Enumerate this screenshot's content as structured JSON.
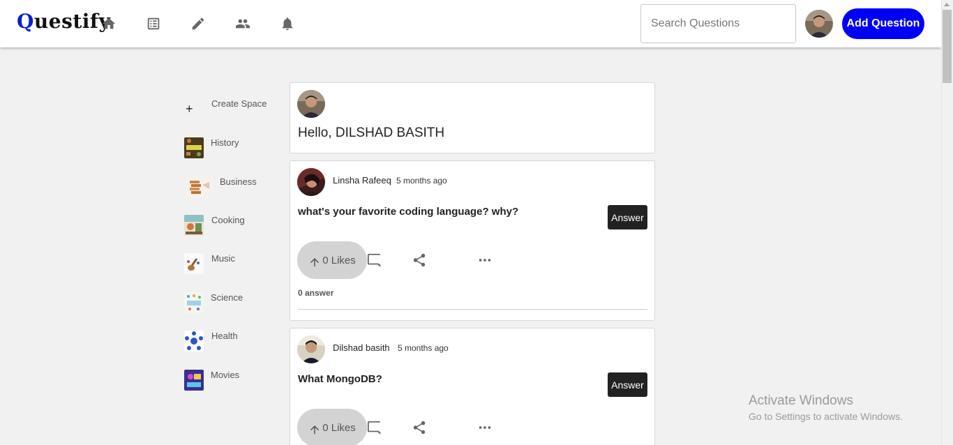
{
  "header": {
    "logo_first": "Q",
    "logo_rest": "uestify",
    "nav": [
      "home-icon",
      "list-icon",
      "edit-icon",
      "people-icon",
      "bell-icon"
    ],
    "search_placeholder": "Search Questions",
    "add_button": "Add Question"
  },
  "sidebar": {
    "create_label": "Create Space",
    "items": [
      {
        "label": "History"
      },
      {
        "label": "Business"
      },
      {
        "label": "Cooking"
      },
      {
        "label": "Music"
      },
      {
        "label": "Science"
      },
      {
        "label": "Health"
      },
      {
        "label": "Movies"
      }
    ]
  },
  "feed": {
    "greeting": "Hello, DILSHAD BASITH",
    "posts": [
      {
        "user": "Linsha Rafeeq",
        "time": "5 months ago",
        "question": "what's your favorite coding language? why?",
        "answer_button": "Answer",
        "likes": "0 Likes",
        "answers": "0 answer"
      },
      {
        "user": "Dilshad basith",
        "time": "5 months ago",
        "question": "What MongoDB?",
        "answer_button": "Answer",
        "likes": "0 Likes"
      }
    ]
  },
  "watermark": {
    "title": "Activate Windows",
    "subtitle": "Go to Settings to activate Windows."
  },
  "colors": {
    "brand": "#0000f5",
    "logo_q": "#0a1fd6",
    "answer_button_bg": "#222222",
    "like_button_bg": "#d3d3d3"
  }
}
